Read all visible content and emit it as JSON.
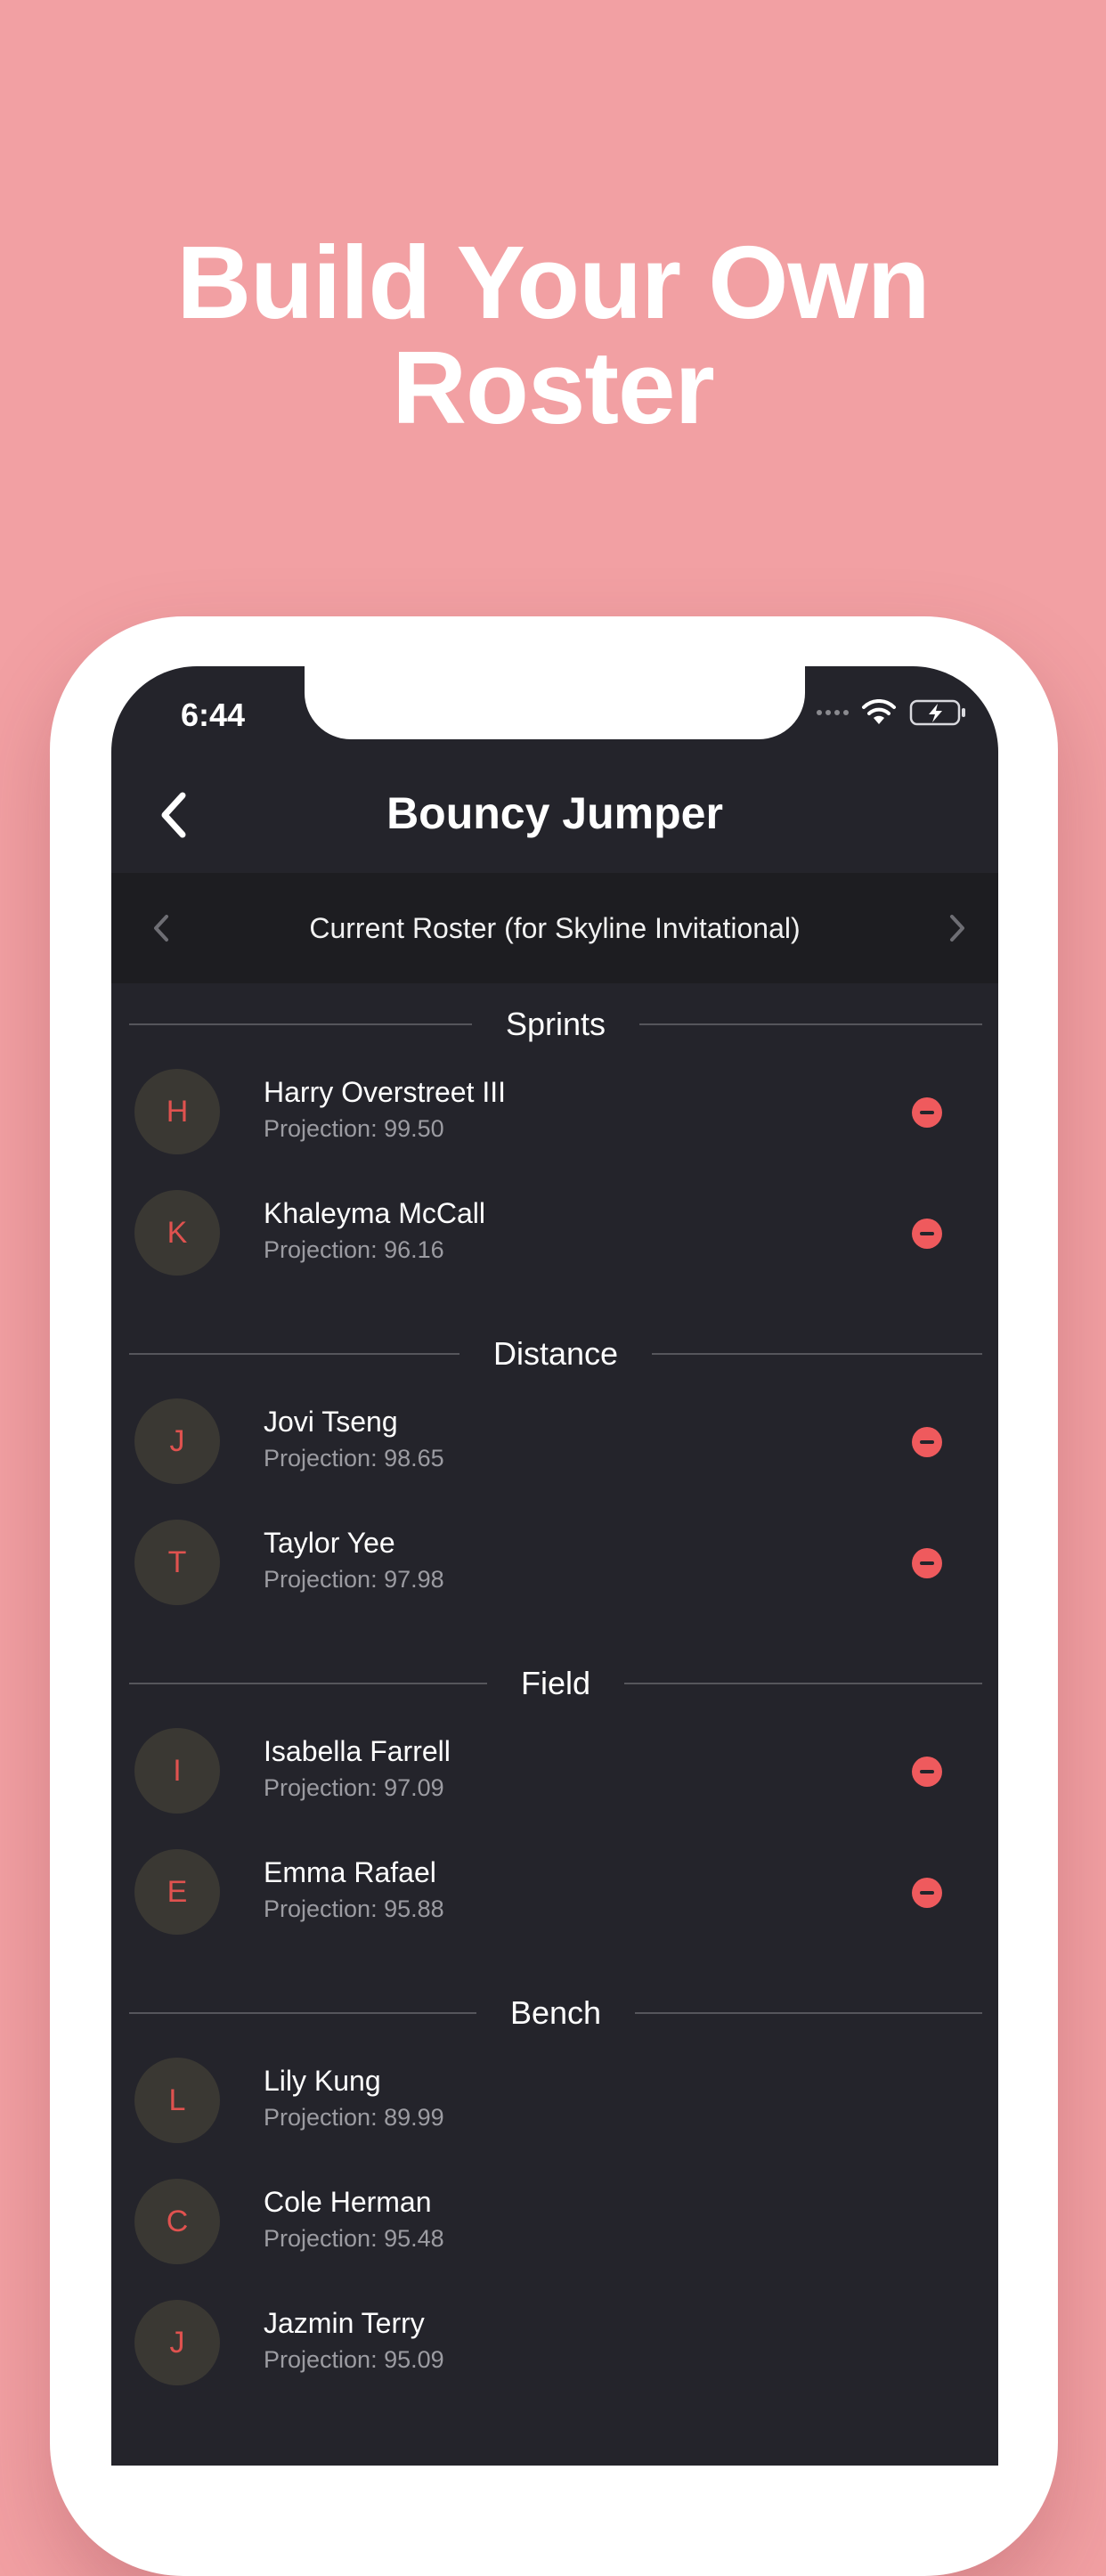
{
  "headline": {
    "line1": "Build Your Own",
    "line2": "Roster"
  },
  "status_bar": {
    "time": "6:44",
    "icons": [
      "signal-icon",
      "wifi-icon",
      "battery-charging-icon"
    ]
  },
  "nav": {
    "title": "Bouncy Jumper",
    "back_icon": "chevron-left-icon"
  },
  "roster_selector": {
    "label": "Current Roster (for Skyline Invitational)"
  },
  "colors": {
    "background": "#f2a0a3",
    "screen": "#24242b",
    "accent": "#ef5a5d"
  },
  "sections": [
    {
      "title": "Sprints",
      "players": [
        {
          "initial": "H",
          "name": "Harry Overstreet III",
          "projection": "Projection: 99.50",
          "removable": true
        },
        {
          "initial": "K",
          "name": "Khaleyma McCall",
          "projection": "Projection: 96.16",
          "removable": true
        }
      ]
    },
    {
      "title": "Distance",
      "players": [
        {
          "initial": "J",
          "name": "Jovi Tseng",
          "projection": "Projection: 98.65",
          "removable": true
        },
        {
          "initial": "T",
          "name": "Taylor Yee",
          "projection": "Projection: 97.98",
          "removable": true
        }
      ]
    },
    {
      "title": "Field",
      "players": [
        {
          "initial": "I",
          "name": "Isabella Farrell",
          "projection": "Projection: 97.09",
          "removable": true
        },
        {
          "initial": "E",
          "name": "Emma Rafael",
          "projection": "Projection: 95.88",
          "removable": true
        }
      ]
    },
    {
      "title": "Bench",
      "players": [
        {
          "initial": "L",
          "name": "Lily Kung",
          "projection": "Projection: 89.99",
          "removable": false
        },
        {
          "initial": "C",
          "name": "Cole Herman",
          "projection": "Projection: 95.48",
          "removable": false
        },
        {
          "initial": "J",
          "name": "Jazmin Terry",
          "projection": "Projection: 95.09",
          "removable": false
        }
      ]
    }
  ]
}
